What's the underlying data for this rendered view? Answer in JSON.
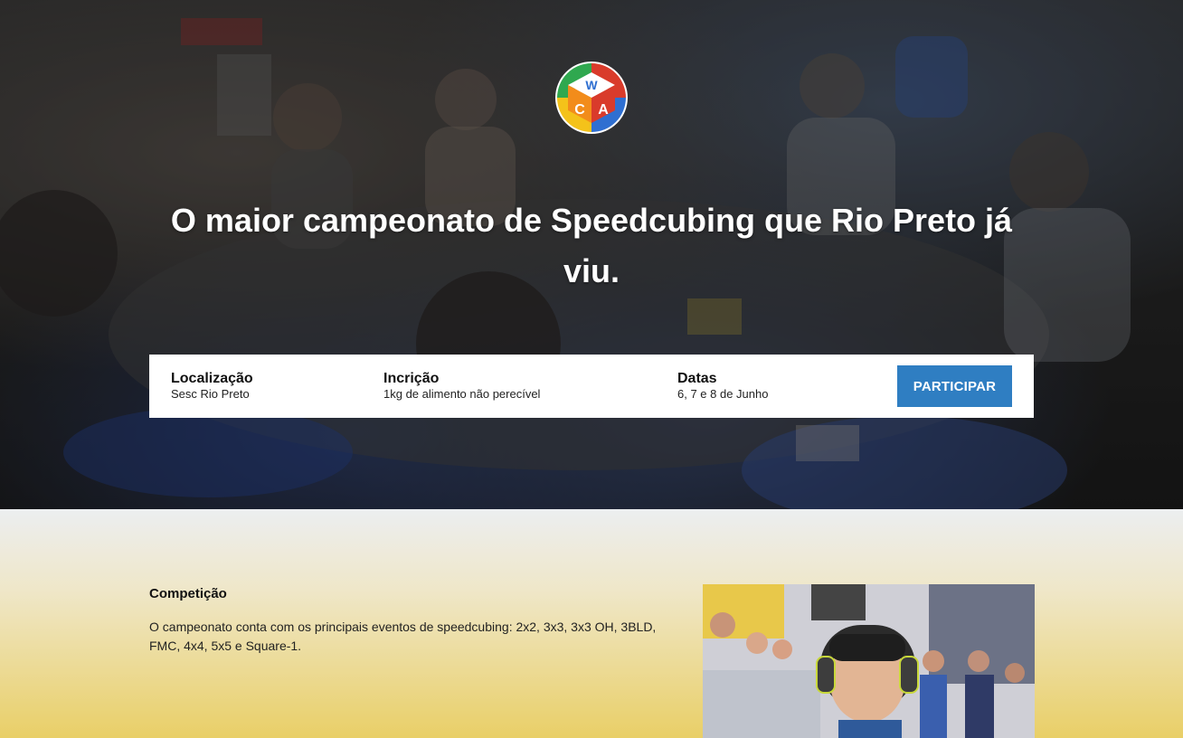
{
  "hero": {
    "title": "O maior campeonato de Speedcubing que Rio Preto já viu."
  },
  "info_bar": {
    "location_label": "Localização",
    "location_value": "Sesc Rio Preto",
    "registration_label": "Incrição",
    "registration_value": "1kg de alimento não perecível",
    "dates_label": "Datas",
    "dates_value": "6, 7 e 8 de Junho",
    "cta_label": "PARTICIPAR"
  },
  "competition": {
    "title": "Competição",
    "text": "O campeonato conta com os principais eventos de speedcubing: 2x2, 3x3, 3x3 OH, 3BLD, FMC, 4x4, 5x5 e Square-1."
  },
  "colors": {
    "accent": "#2f7ec2",
    "gradient_top": "#eceef0",
    "gradient_bottom": "#e9cf67"
  },
  "icons": {
    "logo": "wca-logo-icon"
  }
}
